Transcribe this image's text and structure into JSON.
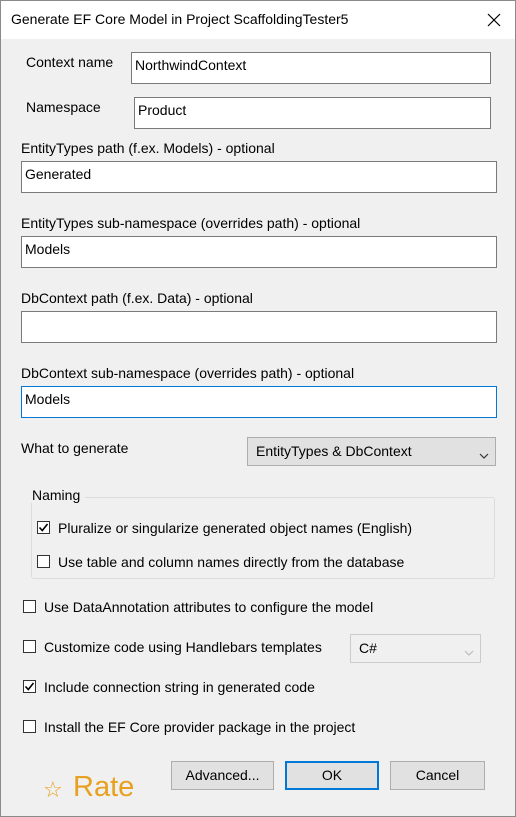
{
  "window": {
    "title": "Generate EF Core Model in Project ScaffoldingTester5"
  },
  "fields": {
    "context_name": {
      "label": "Context name",
      "value": "NorthwindContext"
    },
    "namespace": {
      "label": "Namespace",
      "value": "Product"
    },
    "entitytypes_path": {
      "label": "EntityTypes path (f.ex. Models) - optional",
      "value": "Generated"
    },
    "entitytypes_subnamespace": {
      "label": "EntityTypes sub-namespace (overrides path) - optional",
      "value": "Models"
    },
    "dbcontext_path": {
      "label": "DbContext path (f.ex. Data) - optional",
      "value": ""
    },
    "dbcontext_subnamespace": {
      "label": "DbContext sub-namespace (overrides path) - optional",
      "value": "Models"
    }
  },
  "what_to_generate": {
    "label": "What to generate",
    "selected": "EntityTypes & DbContext"
  },
  "naming": {
    "label": "Naming",
    "options": [
      {
        "label": "Pluralize or singularize generated object names (English)",
        "checked": true
      },
      {
        "label": "Use table and column names directly from the database",
        "checked": false
      }
    ]
  },
  "options": [
    {
      "label": "Use DataAnnotation attributes to configure the model",
      "checked": false
    },
    {
      "label": "Customize code using Handlebars templates",
      "checked": false
    },
    {
      "label": "Include connection string in generated code",
      "checked": true
    },
    {
      "label": "Install the EF Core provider package in the project",
      "checked": false
    }
  ],
  "template_language": {
    "selected": "C#"
  },
  "buttons": {
    "advanced": "Advanced...",
    "ok": "OK",
    "cancel": "Cancel"
  },
  "rate": {
    "star": "☆",
    "label": "Rate"
  },
  "colors": {
    "accent": "#0078d7",
    "rate": "#e8a020",
    "dialog_bg": "#f0f0f0"
  },
  "icons": {
    "close": "close-icon",
    "dropdown": "chevron-down-icon",
    "check": "checkmark-icon",
    "star": "star-icon"
  }
}
